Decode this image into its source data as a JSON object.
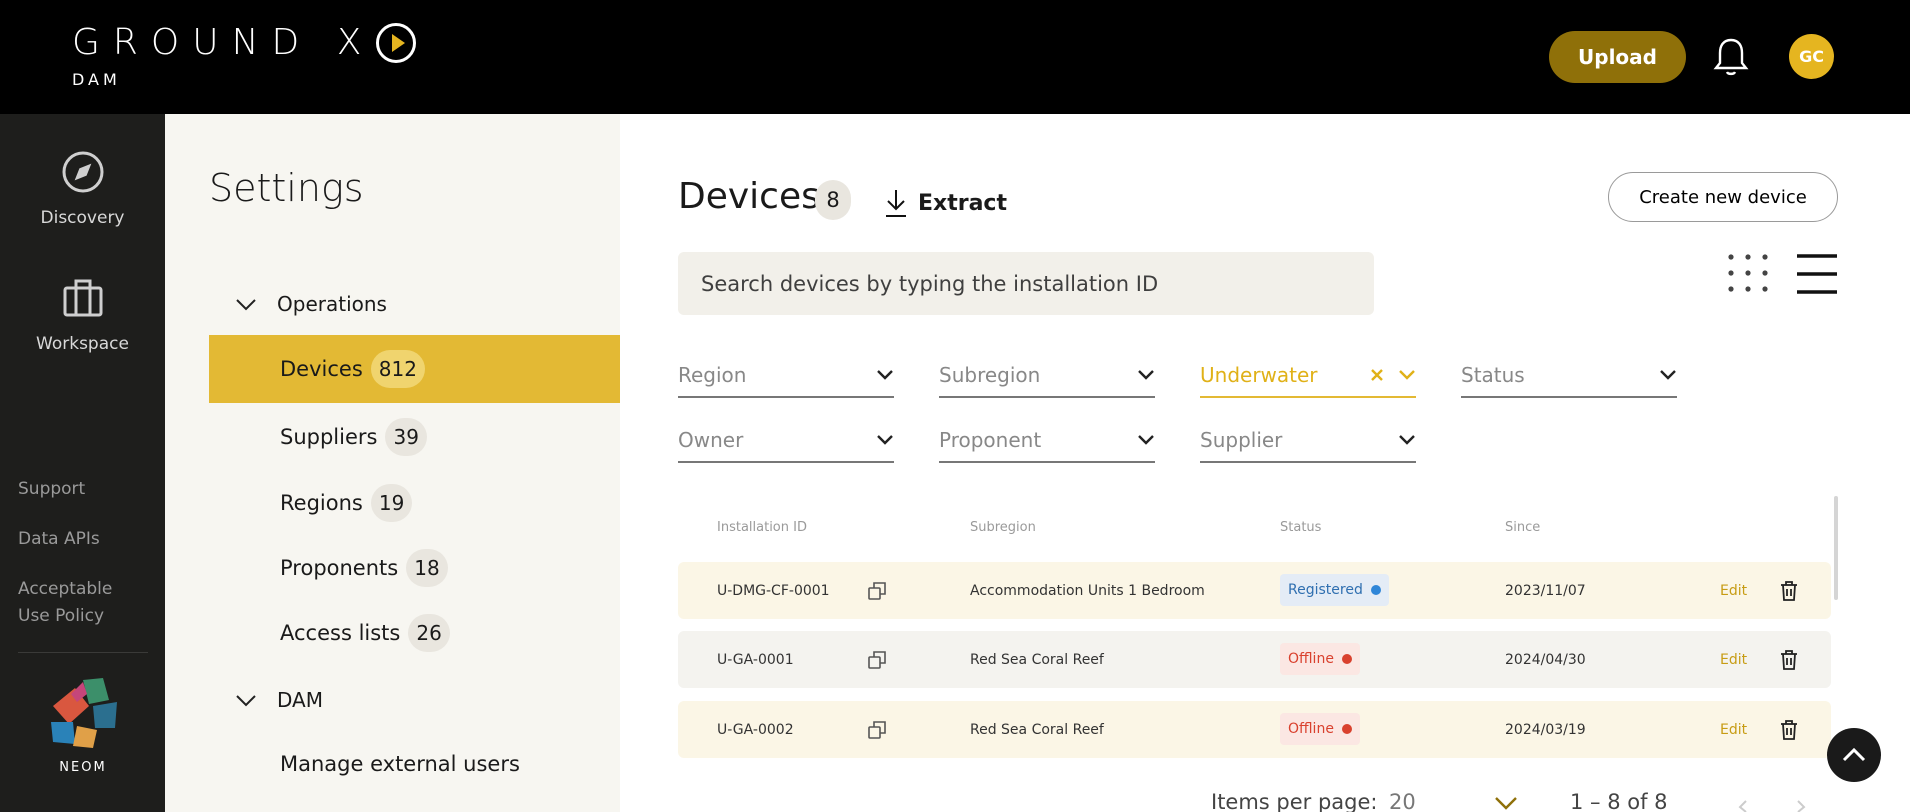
{
  "header": {
    "logo_text": "GROUND X",
    "logo_sub": "DAM",
    "upload_label": "Upload",
    "avatar_initials": "GC",
    "accent": "#e5b520"
  },
  "rail": {
    "discovery_label": "Discovery",
    "workspace_label": "Workspace",
    "links": [
      "Support",
      "Data APIs",
      "Acceptable Use Policy"
    ],
    "brand_label": "NEOM"
  },
  "settings": {
    "title": "Settings",
    "groups": [
      {
        "label": "Operations"
      },
      {
        "label": "DAM"
      }
    ],
    "items": [
      {
        "label": "Devices",
        "count": "812",
        "active": true
      },
      {
        "label": "Suppliers",
        "count": "39"
      },
      {
        "label": "Regions",
        "count": "19"
      },
      {
        "label": "Proponents",
        "count": "18"
      },
      {
        "label": "Access lists",
        "count": "26"
      },
      {
        "label": "Manage external users"
      }
    ]
  },
  "main": {
    "title": "Devices",
    "count": "8",
    "extract_label": "Extract",
    "create_label": "Create new device",
    "search_placeholder": "Search devices by typing the installation ID",
    "filters": [
      {
        "label": "Region"
      },
      {
        "label": "Subregion"
      },
      {
        "label": "Underwater",
        "selected": true
      },
      {
        "label": "Status"
      },
      {
        "label": "Owner"
      },
      {
        "label": "Proponent"
      },
      {
        "label": "Supplier"
      }
    ],
    "columns": [
      "Installation ID",
      "Subregion",
      "Status",
      "Since"
    ],
    "rows": [
      {
        "id": "U-DMG-CF-0001",
        "subregion": "Accommodation Units 1 Bedroom",
        "status": "Registered",
        "since": "2023/11/07",
        "edit": "Edit"
      },
      {
        "id": "U-GA-0001",
        "subregion": "Red Sea Coral Reef",
        "status": "Offline",
        "since": "2024/04/30",
        "edit": "Edit"
      },
      {
        "id": "U-GA-0002",
        "subregion": "Red Sea Coral Reef",
        "status": "Offline",
        "since": "2024/03/19",
        "edit": "Edit"
      }
    ],
    "status_colors": {
      "Registered": "#2f86d8",
      "Offline": "#d9412e"
    },
    "pager": {
      "items_per_page_label": "Items per page:",
      "items_per_page": "20",
      "range": "1 – 8 of 8"
    }
  }
}
